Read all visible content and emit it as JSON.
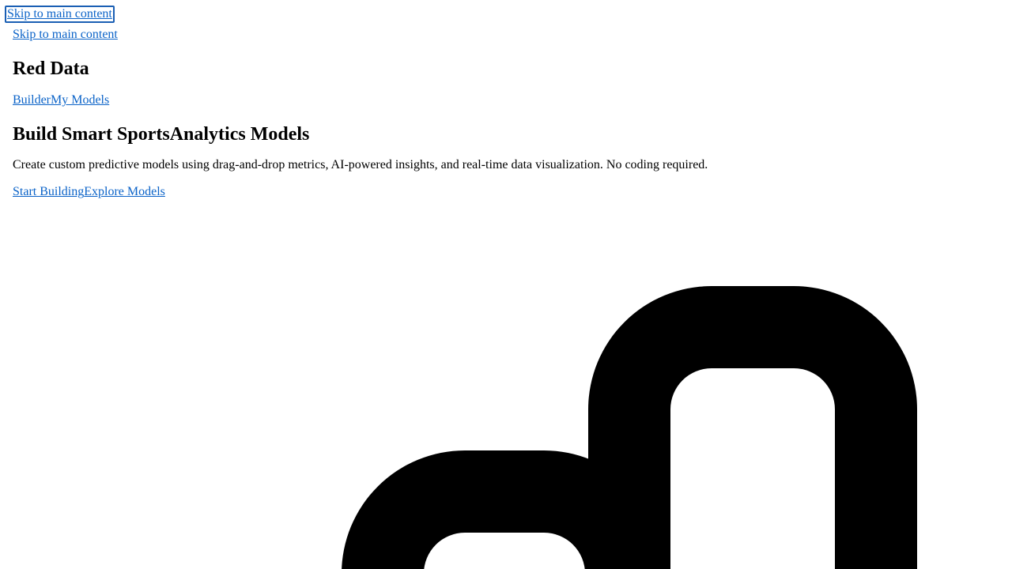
{
  "skip_focused": {
    "label": "Skip to main content"
  },
  "skip_link": {
    "label": "Skip to main content"
  },
  "brand": {
    "name": "Red Data"
  },
  "nav": {
    "items": [
      {
        "label": "Builder"
      },
      {
        "label": "My Models"
      }
    ]
  },
  "hero": {
    "title_part1": "Build Smart Sports",
    "title_part2": "Analytics Models",
    "subtitle": "Create custom predictive models using drag-and-drop metrics, AI-powered insights, and real-time data visualization. No coding required.",
    "cta_primary": "Start Building",
    "cta_secondary": "Explore Models"
  },
  "colors": {
    "link": "#0b63c8",
    "focus_ring": "#1a5fb4",
    "graphic_fill": "#000000"
  },
  "icons": {
    "hero_graphic": "bar-chart-icon"
  }
}
